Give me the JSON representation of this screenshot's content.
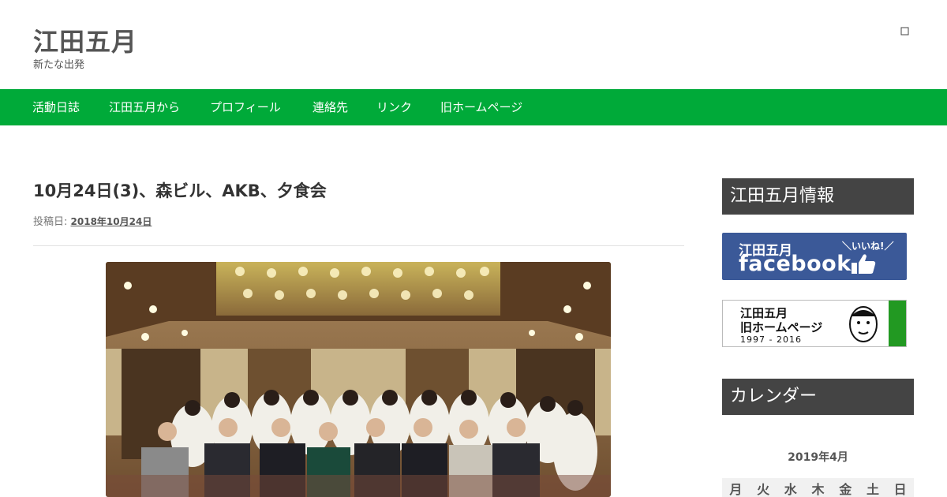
{
  "site": {
    "title": "江田五月",
    "description": "新たな出発"
  },
  "header_icon": "search-icon",
  "nav": {
    "items": [
      {
        "label": "活動日誌"
      },
      {
        "label": "江田五月から"
      },
      {
        "label": "プロフィール"
      },
      {
        "label": "連絡先"
      },
      {
        "label": "リンク"
      },
      {
        "label": "旧ホームページ"
      }
    ]
  },
  "post": {
    "title": "10月24日(3)、森ビル、AKB、夕食会",
    "meta_label": "投稿日:",
    "date": "2018年10月24日"
  },
  "sidebar": {
    "info_title": "江田五月情報",
    "facebook_banner": {
      "line1": "江田五月",
      "line2": "facebook",
      "tag": "＼いいね!／"
    },
    "old_banner": {
      "line1": "江田五月",
      "line2": "旧ホームページ",
      "years": "1997 - 2016"
    },
    "calendar_title": "カレンダー",
    "calendar_caption": "2019年4月",
    "weekdays": [
      "月",
      "火",
      "水",
      "木",
      "金",
      "土",
      "日"
    ]
  },
  "colors": {
    "nav_bg": "#00aa39",
    "widget_title_bg": "#444444",
    "facebook_blue": "#3b5998"
  }
}
